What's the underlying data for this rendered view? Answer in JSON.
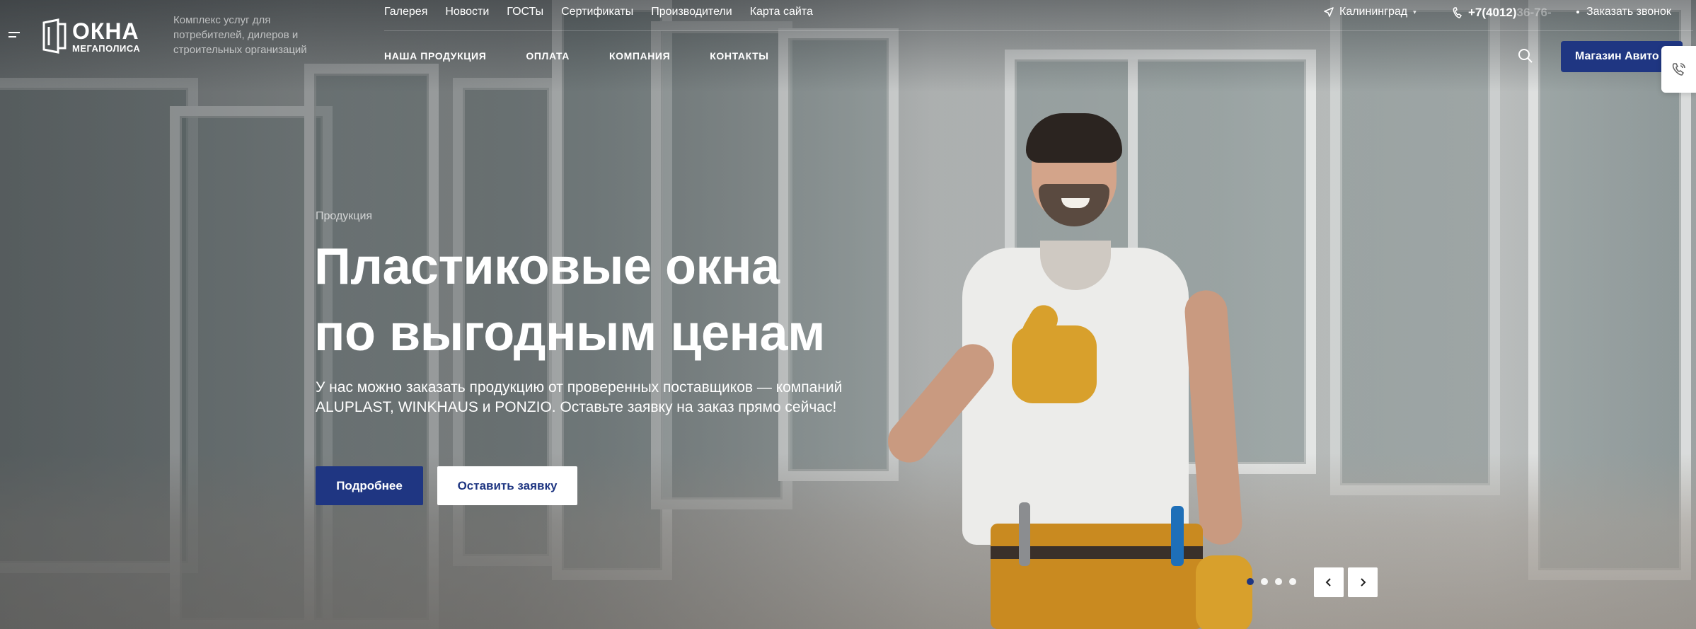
{
  "header": {
    "logo_big": "ОКНА",
    "logo_small": "МЕГАПОЛИСА",
    "tagline": "Комплекс услуг для потребителей, дилеров и строительных организаций",
    "top_links": [
      "Галерея",
      "Новости",
      "ГОСТы",
      "Сертификаты",
      "Производители",
      "Карта сайта"
    ],
    "main_links": [
      "НАША ПРОДУКЦИЯ",
      "ОПЛАТА",
      "КОМПАНИЯ",
      "КОНТАКТЫ"
    ],
    "city": "Калининград",
    "phone_visible": "+7(4012)",
    "phone_faded": "36-76-",
    "callback": "Заказать звонок",
    "shop_button": "Магазин Авито"
  },
  "hero": {
    "breadcrumb": "Продукция",
    "title_line1": "Пластиковые окна",
    "title_line2": "по выгодным ценам",
    "lead": "У нас можно заказать продукцию от проверенных поставщиков — компаний ALUPLAST, WINKHAUS и PONZIO. Оставьте заявку на заказ прямо сейчас!",
    "btn_more": "Подробнее",
    "btn_request": "Оставить заявку"
  },
  "slider": {
    "slides_count": 4,
    "active_index": 0
  },
  "icons": {
    "menu": "menu-icon",
    "location": "location-arrow-icon",
    "phone": "phone-icon",
    "search": "search-icon",
    "callback_widget": "phone-callback-icon",
    "prev": "chevron-left-icon",
    "next": "chevron-right-icon"
  },
  "colors": {
    "brand_blue": "#1f3682",
    "white": "#ffffff"
  }
}
